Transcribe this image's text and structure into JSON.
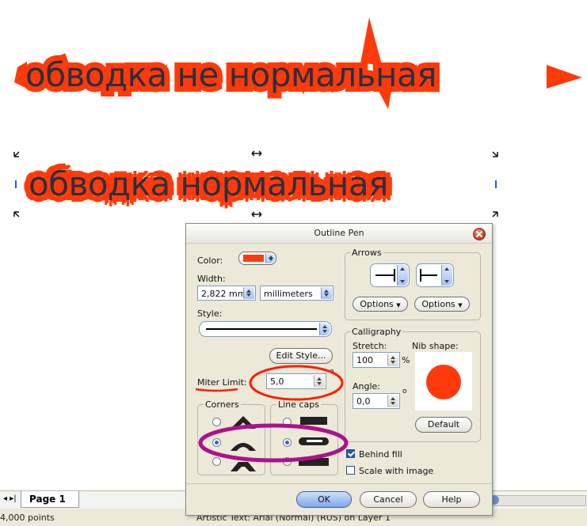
{
  "canvas": {
    "text_bad": "обводка не нормальная",
    "text_good": "обводка нормальная"
  },
  "page_tabs": {
    "page_label": "Page 1"
  },
  "status": {
    "left": "4,000 points",
    "center": "Artistic Text: Arial (Normal) (RUS) on Layer 1"
  },
  "dialog": {
    "title": "Outline Pen",
    "color_label": "Color:",
    "width_label": "Width:",
    "width_value": "2,822 mm",
    "width_unit": "millimeters",
    "style_label": "Style:",
    "edit_style_button": "Edit Style...",
    "miter_label": "Miter Limit:",
    "miter_value": "5,0",
    "degree_symbol": "o",
    "corners_label": "Corners",
    "line_caps_label": "Line caps",
    "arrows_label": "Arrows",
    "options_left": "Options",
    "options_right": "Options",
    "calligraphy_label": "Calligraphy",
    "stretch_label": "Stretch:",
    "stretch_value": "100",
    "percent": "%",
    "angle_label": "Angle:",
    "angle_value": "0,0",
    "nib_shape_label": "Nib shape:",
    "default_button": "Default",
    "behind_fill_label": "Behind fill",
    "scale_with_image_label": "Scale with image",
    "ok_button": "OK",
    "cancel_button": "Cancel",
    "help_button": "Help",
    "colors": {
      "outline_color": "#ff3a0a",
      "annotation_red": "#ff1d00",
      "annotation_magenta": "#b0108c"
    }
  }
}
